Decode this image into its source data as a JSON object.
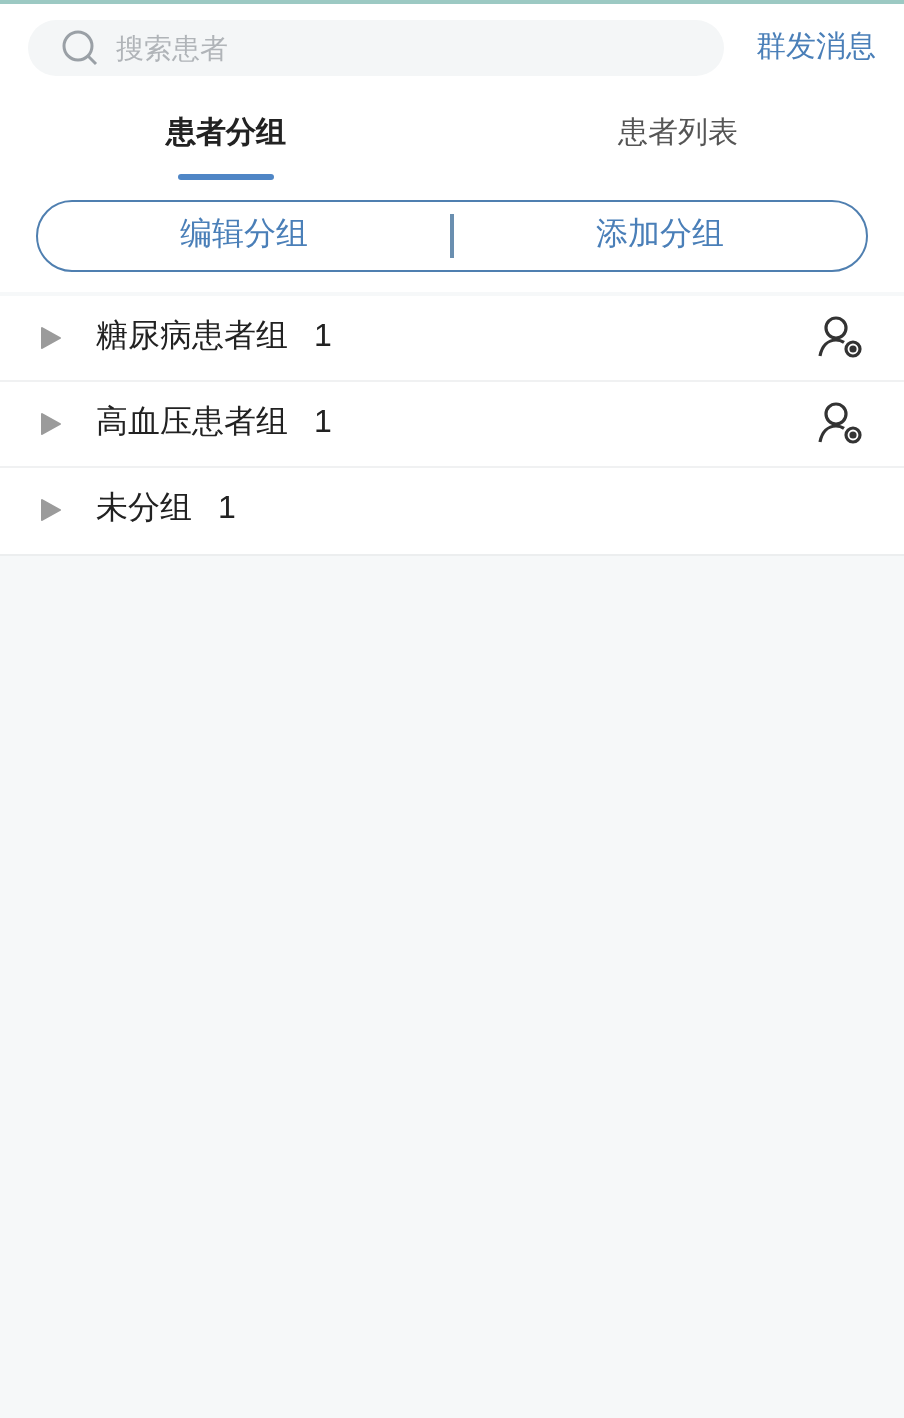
{
  "search": {
    "placeholder": "搜索患者"
  },
  "broadcast_link": "群发消息",
  "tabs": [
    {
      "label": "患者分组",
      "selected": true
    },
    {
      "label": "患者列表",
      "selected": false
    }
  ],
  "actions": [
    "编辑分组",
    "添加分组"
  ],
  "groups": [
    {
      "name": "糖尿病患者组",
      "count": "1",
      "has_member_icon": true
    },
    {
      "name": "高血压患者组",
      "count": "1",
      "has_member_icon": true
    },
    {
      "name": "未分组",
      "count": "1",
      "has_member_icon": false
    }
  ]
}
